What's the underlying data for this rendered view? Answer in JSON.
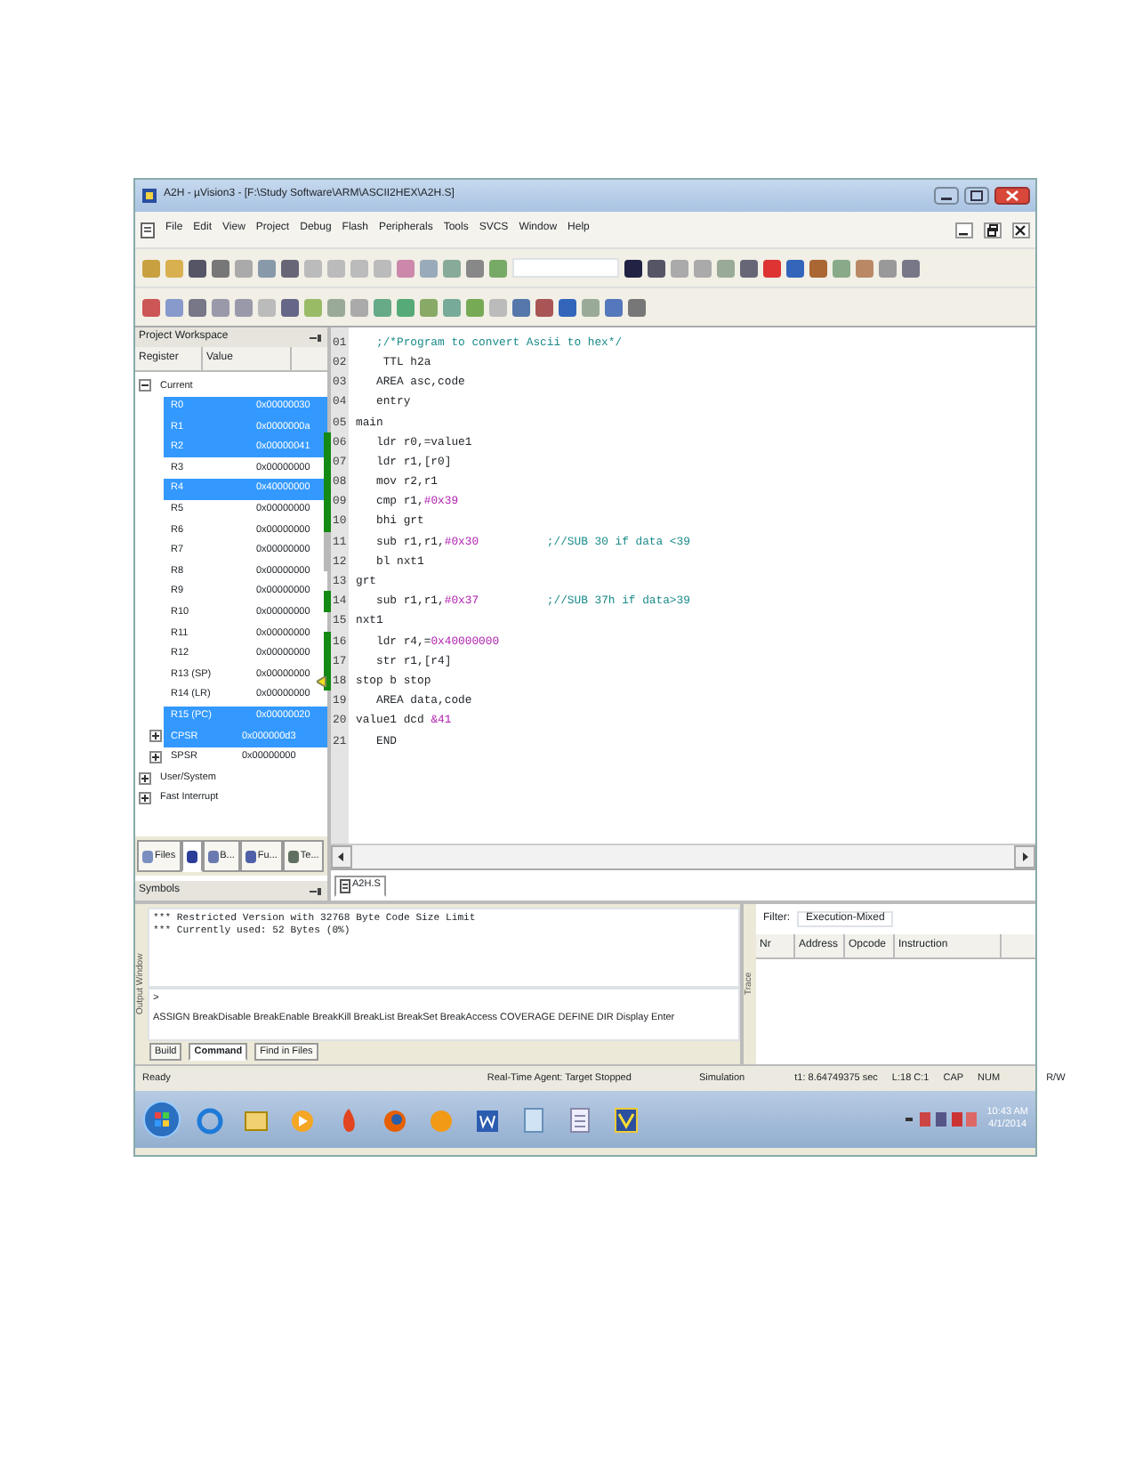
{
  "window": {
    "title": "A2H - µVision3 - [F:\\Study Software\\ARM\\ASCII2HEX\\A2H.S]"
  },
  "menu": [
    "File",
    "Edit",
    "View",
    "Project",
    "Debug",
    "Flash",
    "Peripherals",
    "Tools",
    "SVCS",
    "Window",
    "Help"
  ],
  "workspace": {
    "title": "Project Workspace",
    "columns": [
      "Register",
      "Value"
    ],
    "tree": [
      {
        "label": "Current",
        "expanded": true,
        "children": [
          {
            "label": "R0",
            "value": "0x00000030",
            "selected": true
          },
          {
            "label": "R1",
            "value": "0x0000000a",
            "selected": true
          },
          {
            "label": "R2",
            "value": "0x00000041",
            "selected": true
          },
          {
            "label": "R3",
            "value": "0x00000000",
            "selected": false
          },
          {
            "label": "R4",
            "value": "0x40000000",
            "selected": true
          },
          {
            "label": "R5",
            "value": "0x00000000",
            "selected": false
          },
          {
            "label": "R6",
            "value": "0x00000000",
            "selected": false
          },
          {
            "label": "R7",
            "value": "0x00000000",
            "selected": false
          },
          {
            "label": "R8",
            "value": "0x00000000",
            "selected": false
          },
          {
            "label": "R9",
            "value": "0x00000000",
            "selected": false
          },
          {
            "label": "R10",
            "value": "0x00000000",
            "selected": false
          },
          {
            "label": "R11",
            "value": "0x00000000",
            "selected": false
          },
          {
            "label": "R12",
            "value": "0x00000000",
            "selected": false
          },
          {
            "label": "R13 (SP)",
            "value": "0x00000000",
            "selected": false
          },
          {
            "label": "R14 (LR)",
            "value": "0x00000000",
            "selected": false
          },
          {
            "label": "R15 (PC)",
            "value": "0x00000020",
            "selected": true
          },
          {
            "label": "CPSR",
            "value": "0x000000d3",
            "selected": true,
            "expanded": false
          },
          {
            "label": "SPSR",
            "value": "0x00000000",
            "selected": false,
            "expanded": false
          }
        ]
      },
      {
        "label": "User/System",
        "expanded": false
      },
      {
        "label": "Fast Interrupt",
        "expanded": false
      }
    ],
    "tabs": [
      {
        "label": "Files",
        "selected": false
      },
      {
        "selected": true
      },
      {
        "label": "B...",
        "selected": false
      },
      {
        "label": "Fu...",
        "selected": false
      },
      {
        "label": "Te...",
        "selected": false
      }
    ]
  },
  "symbols": {
    "title": "Symbols"
  },
  "editor": {
    "file_tab": "A2H.S",
    "lines": [
      {
        "number": "01",
        "executed": false,
        "not_executed": false,
        "current": false,
        "parts": [
          {
            "kind": "comment",
            "text": "   ;/*Program to convert Ascii to hex*/"
          }
        ]
      },
      {
        "number": "02",
        "executed": false,
        "not_executed": false,
        "current": false,
        "parts": [
          {
            "kind": "plain",
            "text": "    TTL h2a"
          }
        ]
      },
      {
        "number": "03",
        "executed": false,
        "not_executed": false,
        "current": false,
        "parts": [
          {
            "kind": "plain",
            "text": "   AREA asc,code"
          }
        ]
      },
      {
        "number": "04",
        "executed": false,
        "not_executed": false,
        "current": false,
        "parts": [
          {
            "kind": "plain",
            "text": "   entry"
          }
        ]
      },
      {
        "number": "05",
        "executed": false,
        "not_executed": false,
        "current": false,
        "parts": [
          {
            "kind": "plain",
            "text": "main"
          }
        ]
      },
      {
        "number": "06",
        "executed": true,
        "not_executed": false,
        "current": false,
        "parts": [
          {
            "kind": "plain",
            "text": "   ldr r0,=value1"
          }
        ]
      },
      {
        "number": "07",
        "executed": true,
        "not_executed": false,
        "current": false,
        "parts": [
          {
            "kind": "plain",
            "text": "   ldr r1,[r0]"
          }
        ]
      },
      {
        "number": "08",
        "executed": true,
        "not_executed": false,
        "current": false,
        "parts": [
          {
            "kind": "plain",
            "text": "   mov r2,r1"
          }
        ]
      },
      {
        "number": "09",
        "executed": true,
        "not_executed": false,
        "current": false,
        "parts": [
          {
            "kind": "plain",
            "text": "   cmp r1,"
          },
          {
            "kind": "literal",
            "text": "#0x39"
          }
        ]
      },
      {
        "number": "10",
        "executed": true,
        "not_executed": false,
        "current": false,
        "parts": [
          {
            "kind": "plain",
            "text": "   bhi grt"
          }
        ]
      },
      {
        "number": "11",
        "executed": false,
        "not_executed": true,
        "current": false,
        "parts": [
          {
            "kind": "plain",
            "text": "   sub r1,r1,"
          },
          {
            "kind": "literal",
            "text": "#0x30"
          },
          {
            "kind": "comment",
            "text": "          ;//SUB 30 if data <39"
          }
        ]
      },
      {
        "number": "12",
        "executed": false,
        "not_executed": true,
        "current": false,
        "parts": [
          {
            "kind": "plain",
            "text": "   bl nxt1"
          }
        ]
      },
      {
        "number": "13",
        "executed": false,
        "not_executed": false,
        "current": false,
        "parts": [
          {
            "kind": "plain",
            "text": "grt"
          }
        ]
      },
      {
        "number": "14",
        "executed": true,
        "not_executed": false,
        "current": false,
        "parts": [
          {
            "kind": "plain",
            "text": "   sub r1,r1,"
          },
          {
            "kind": "literal",
            "text": "#0x37"
          },
          {
            "kind": "comment",
            "text": "          ;//SUB 37h if data>39"
          }
        ]
      },
      {
        "number": "15",
        "executed": false,
        "not_executed": false,
        "current": false,
        "parts": [
          {
            "kind": "plain",
            "text": "nxt1"
          }
        ]
      },
      {
        "number": "16",
        "executed": true,
        "not_executed": false,
        "current": false,
        "parts": [
          {
            "kind": "plain",
            "text": "   ldr r4,="
          },
          {
            "kind": "literal",
            "text": "0x40000000"
          }
        ]
      },
      {
        "number": "17",
        "executed": true,
        "not_executed": false,
        "current": false,
        "parts": [
          {
            "kind": "plain",
            "text": "   str r1,[r4]"
          }
        ]
      },
      {
        "number": "18",
        "executed": true,
        "not_executed": false,
        "current": true,
        "parts": [
          {
            "kind": "plain",
            "text": "stop b stop"
          }
        ]
      },
      {
        "number": "19",
        "executed": false,
        "not_executed": false,
        "current": false,
        "parts": [
          {
            "kind": "plain",
            "text": "   AREA data,code"
          }
        ]
      },
      {
        "number": "20",
        "executed": false,
        "not_executed": false,
        "current": false,
        "parts": [
          {
            "kind": "plain",
            "text": "value1 dcd "
          },
          {
            "kind": "literal",
            "text": "&41"
          }
        ]
      },
      {
        "number": "21",
        "executed": false,
        "not_executed": false,
        "current": false,
        "parts": [
          {
            "kind": "plain",
            "text": "   END"
          }
        ]
      }
    ]
  },
  "output": {
    "title": "Output Window",
    "lines": [
      "*** Restricted Version with 32768 Byte Code Size Limit",
      "*** Currently used: 52 Bytes (0%)"
    ],
    "prompt": ">",
    "hint": "ASSIGN BreakDisable BreakEnable BreakKill BreakList BreakSet BreakAccess COVERAGE DEFINE DIR Display Enter",
    "tabs": [
      {
        "label": "Build",
        "selected": false
      },
      {
        "label": "Command",
        "selected": true
      },
      {
        "label": "Find in Files",
        "selected": false
      }
    ]
  },
  "trace": {
    "title": "Trace",
    "filter_label": "Filter:",
    "filter_value": "Execution-Mixed",
    "columns": [
      "Nr",
      "Address",
      "Opcode",
      "Instruction"
    ]
  },
  "status_bar": [
    "Ready",
    "Real-Time Agent: Target Stopped",
    "Simulation",
    "t1: 8.64749375 sec",
    "L:18 C:1",
    "CAP",
    "NUM",
    "R/W"
  ],
  "taskbar": {
    "time": "10:43 AM",
    "date": "4/1/2014"
  }
}
